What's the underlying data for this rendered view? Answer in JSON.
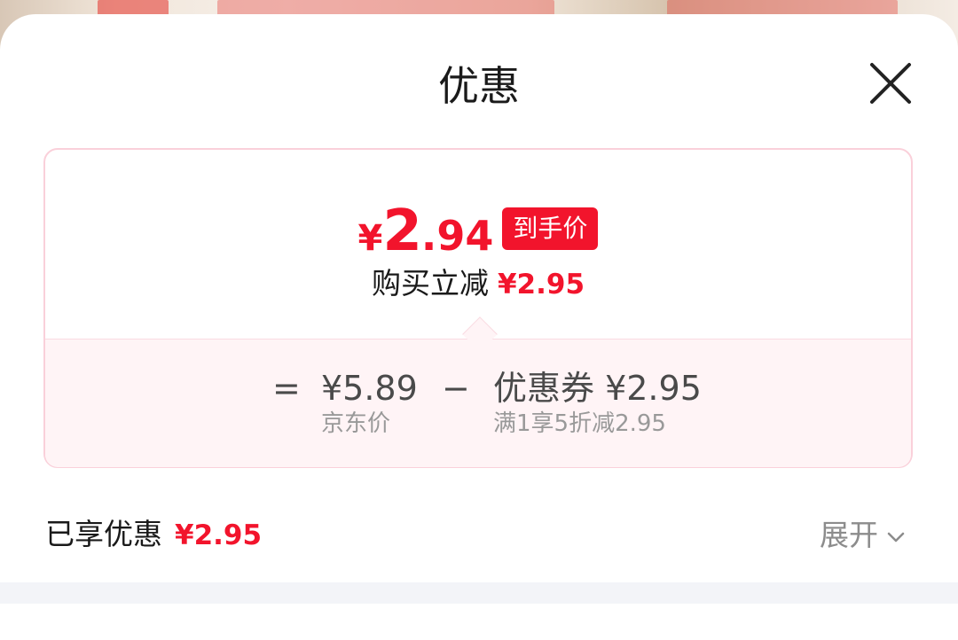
{
  "sheet": {
    "title": "优惠"
  },
  "final_price": {
    "currency": "¥",
    "integer": "2",
    "decimal": ".94",
    "tag": "到手价"
  },
  "instant_discount": {
    "label": "购买立减",
    "amount": "¥2.95"
  },
  "formula": {
    "equals": "=",
    "minus": "−",
    "base_price": "¥5.89",
    "base_label": "京东价",
    "coupon_price": "优惠券 ¥2.95",
    "coupon_label": "满1享5折减2.95"
  },
  "enjoyed": {
    "label": "已享优惠",
    "amount": "¥2.95"
  },
  "expand": {
    "label": "展开"
  },
  "colors": {
    "accent": "#f2142c",
    "card_border": "#fad0da",
    "card_bottom_bg": "#fff4f6"
  }
}
